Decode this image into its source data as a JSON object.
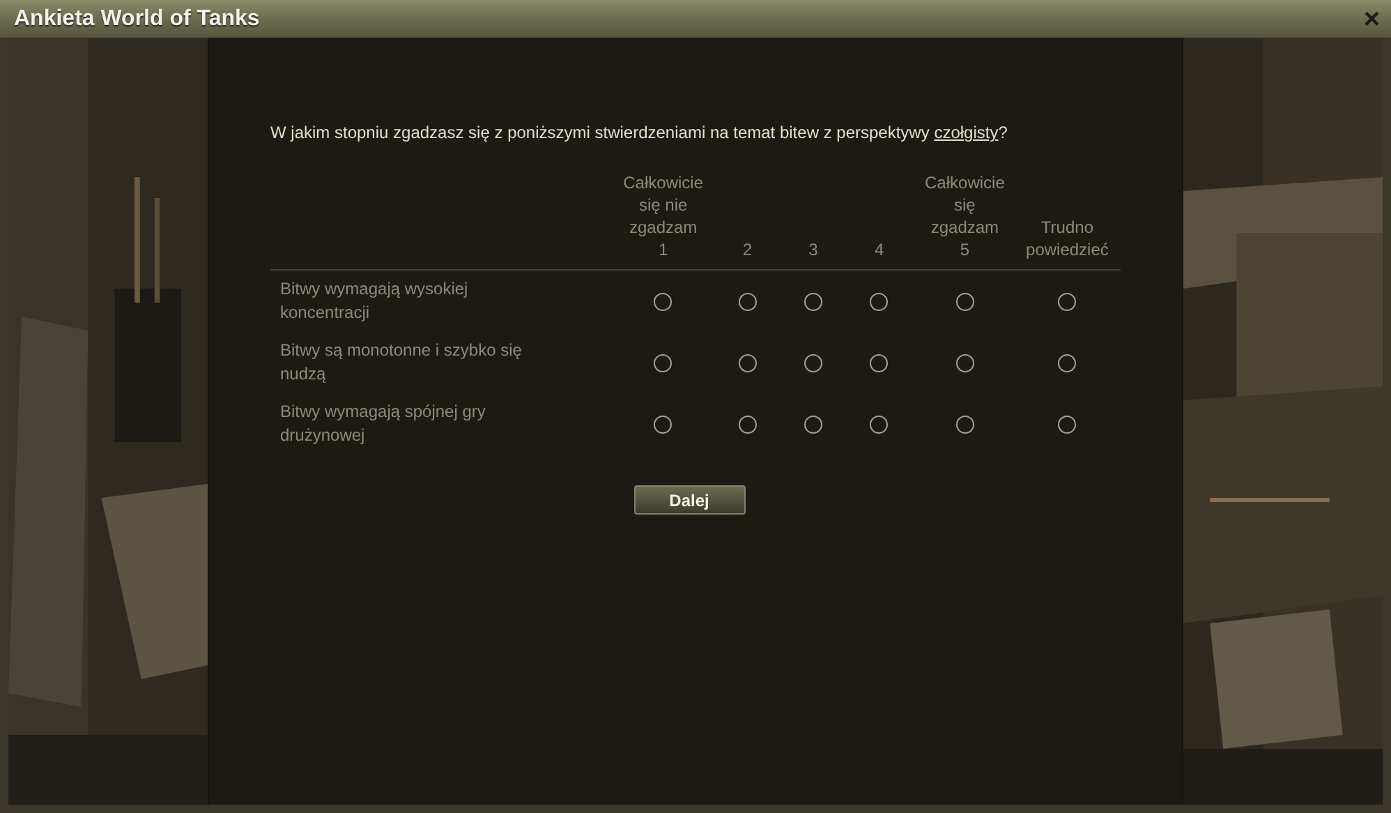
{
  "window": {
    "title": "Ankieta World of Tanks",
    "close": "×"
  },
  "question": {
    "text": "W jakim stopniu zgadzasz się z poniższymi stwierdzeniami na temat bitew z perspektywy ",
    "link": "czołgisty",
    "after": "?"
  },
  "columns": [
    {
      "lines": [
        "Całkowicie",
        "się nie",
        "zgadzam",
        "1"
      ]
    },
    {
      "lines": [
        "2"
      ]
    },
    {
      "lines": [
        "3"
      ]
    },
    {
      "lines": [
        "4"
      ]
    },
    {
      "lines": [
        "Całkowicie",
        "się",
        "zgadzam",
        "5"
      ]
    },
    {
      "lines": [
        "Trudno",
        "powiedzieć"
      ]
    }
  ],
  "rows": [
    {
      "statement": "Bitwy wymagają wysokiej koncentracji",
      "options": [
        {
          "selected": false
        },
        {
          "selected": false
        },
        {
          "selected": false
        },
        {
          "selected": false
        },
        {
          "selected": false
        },
        {
          "selected": false
        }
      ]
    },
    {
      "statement": "Bitwy są monotonne i szybko się nudzą",
      "options": [
        {
          "selected": false
        },
        {
          "selected": false
        },
        {
          "selected": false
        },
        {
          "selected": false
        },
        {
          "selected": false
        },
        {
          "selected": false
        }
      ]
    },
    {
      "statement": "Bitwy wymagają spójnej gry drużynowej",
      "options": [
        {
          "selected": false
        },
        {
          "selected": false
        },
        {
          "selected": false
        },
        {
          "selected": false
        },
        {
          "selected": false
        },
        {
          "selected": false
        }
      ]
    }
  ],
  "button": "Dalej"
}
